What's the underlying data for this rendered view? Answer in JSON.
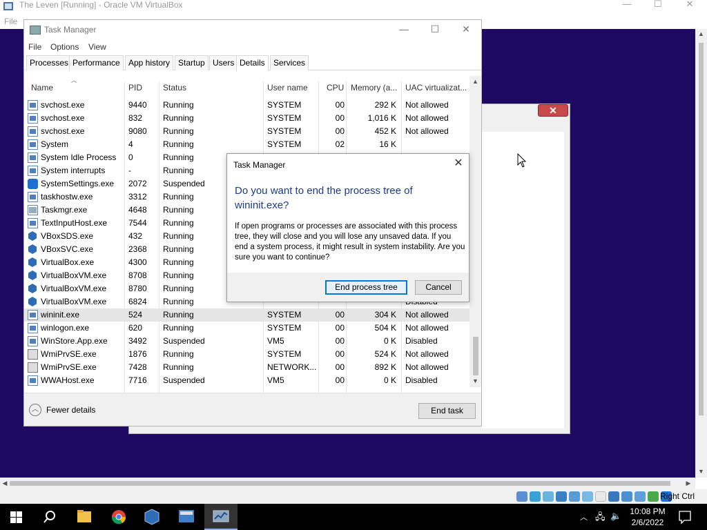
{
  "vbox": {
    "title": "The Leven [Running] - Oracle VM VirtualBox",
    "menu_file": "File",
    "minimize": "—",
    "maximize": "☐",
    "close": "✕",
    "host_key": "Right Ctrl"
  },
  "taskmgr": {
    "title": "Task Manager",
    "menu": [
      "File",
      "Options",
      "View"
    ],
    "tabs": [
      "Processes",
      "Performance",
      "App history",
      "Startup",
      "Users",
      "Details",
      "Services"
    ],
    "active_tab": "Details",
    "columns": [
      "Name",
      "PID",
      "Status",
      "User name",
      "CPU",
      "Memory (a...",
      "UAC virtualizat..."
    ],
    "rows": [
      {
        "name": "svchost.exe",
        "pid": "9440",
        "status": "Running",
        "user": "SYSTEM",
        "cpu": "00",
        "mem": "292 K",
        "uac": "Not allowed",
        "icon": "app"
      },
      {
        "name": "svchost.exe",
        "pid": "832",
        "status": "Running",
        "user": "SYSTEM",
        "cpu": "00",
        "mem": "1,016 K",
        "uac": "Not allowed",
        "icon": "app"
      },
      {
        "name": "svchost.exe",
        "pid": "9080",
        "status": "Running",
        "user": "SYSTEM",
        "cpu": "00",
        "mem": "452 K",
        "uac": "Not allowed",
        "icon": "app"
      },
      {
        "name": "System",
        "pid": "4",
        "status": "Running",
        "user": "SYSTEM",
        "cpu": "02",
        "mem": "16 K",
        "uac": "",
        "icon": "app"
      },
      {
        "name": "System Idle Process",
        "pid": "0",
        "status": "Running",
        "user": "",
        "cpu": "",
        "mem": "",
        "uac": "",
        "icon": "app"
      },
      {
        "name": "System interrupts",
        "pid": "-",
        "status": "Running",
        "user": "",
        "cpu": "",
        "mem": "",
        "uac": "",
        "icon": "app"
      },
      {
        "name": "SystemSettings.exe",
        "pid": "2072",
        "status": "Suspended",
        "user": "",
        "cpu": "",
        "mem": "",
        "uac": "",
        "icon": "gear"
      },
      {
        "name": "taskhostw.exe",
        "pid": "3312",
        "status": "Running",
        "user": "",
        "cpu": "",
        "mem": "",
        "uac": "",
        "icon": "app"
      },
      {
        "name": "Taskmgr.exe",
        "pid": "4648",
        "status": "Running",
        "user": "",
        "cpu": "",
        "mem": "",
        "uac": "",
        "icon": "tm"
      },
      {
        "name": "TextInputHost.exe",
        "pid": "7544",
        "status": "Running",
        "user": "",
        "cpu": "",
        "mem": "",
        "uac": "",
        "icon": "app"
      },
      {
        "name": "VBoxSDS.exe",
        "pid": "432",
        "status": "Running",
        "user": "",
        "cpu": "",
        "mem": "",
        "uac": "",
        "icon": "vbox"
      },
      {
        "name": "VBoxSVC.exe",
        "pid": "2368",
        "status": "Running",
        "user": "",
        "cpu": "",
        "mem": "",
        "uac": "",
        "icon": "vbox"
      },
      {
        "name": "VirtualBox.exe",
        "pid": "4300",
        "status": "Running",
        "user": "",
        "cpu": "",
        "mem": "",
        "uac": "",
        "icon": "vbox"
      },
      {
        "name": "VirtualBoxVM.exe",
        "pid": "8708",
        "status": "Running",
        "user": "",
        "cpu": "",
        "mem": "",
        "uac": "",
        "icon": "vbox"
      },
      {
        "name": "VirtualBoxVM.exe",
        "pid": "8780",
        "status": "Running",
        "user": "",
        "cpu": "",
        "mem": "",
        "uac": "",
        "icon": "vbox"
      },
      {
        "name": "VirtualBoxVM.exe",
        "pid": "6824",
        "status": "Running",
        "user": "",
        "cpu": "",
        "mem": "",
        "uac": "Disabled",
        "icon": "vbox"
      },
      {
        "name": "wininit.exe",
        "pid": "524",
        "status": "Running",
        "user": "SYSTEM",
        "cpu": "00",
        "mem": "304 K",
        "uac": "Not allowed",
        "icon": "app",
        "selected": true
      },
      {
        "name": "winlogon.exe",
        "pid": "620",
        "status": "Running",
        "user": "SYSTEM",
        "cpu": "00",
        "mem": "504 K",
        "uac": "Not allowed",
        "icon": "app"
      },
      {
        "name": "WinStore.App.exe",
        "pid": "3492",
        "status": "Suspended",
        "user": "VM5",
        "cpu": "00",
        "mem": "0 K",
        "uac": "Disabled",
        "icon": "app"
      },
      {
        "name": "WmiPrvSE.exe",
        "pid": "1876",
        "status": "Running",
        "user": "SYSTEM",
        "cpu": "00",
        "mem": "524 K",
        "uac": "Not allowed",
        "icon": "wmi"
      },
      {
        "name": "WmiPrvSE.exe",
        "pid": "7428",
        "status": "Running",
        "user": "NETWORK...",
        "cpu": "00",
        "mem": "892 K",
        "uac": "Not allowed",
        "icon": "wmi"
      },
      {
        "name": "WWAHost.exe",
        "pid": "7716",
        "status": "Suspended",
        "user": "VM5",
        "cpu": "00",
        "mem": "0 K",
        "uac": "Disabled",
        "icon": "app"
      }
    ],
    "fewer_details": "Fewer details",
    "end_task": "End task"
  },
  "dialog": {
    "title": "Task Manager",
    "question": "Do you want to end the process tree of wininit.exe?",
    "message": "If open programs or processes are associated with this process tree, they will close and you will lose any unsaved data. If you end a system process, it might result in system instability. Are you sure you want to continue?",
    "confirm": "End process tree",
    "cancel": "Cancel"
  },
  "host_taskbar": {
    "time": "10:08 PM",
    "date": "2/6/2022",
    "apps": [
      "start-button",
      "search-button",
      "file-explorer",
      "chrome",
      "virtualbox",
      "calculator-app",
      "task-manager"
    ]
  },
  "colors": {
    "guest_desktop": "#1e0a63",
    "dialog_heading": "#1c3a8a",
    "accent": "#0078d7"
  }
}
